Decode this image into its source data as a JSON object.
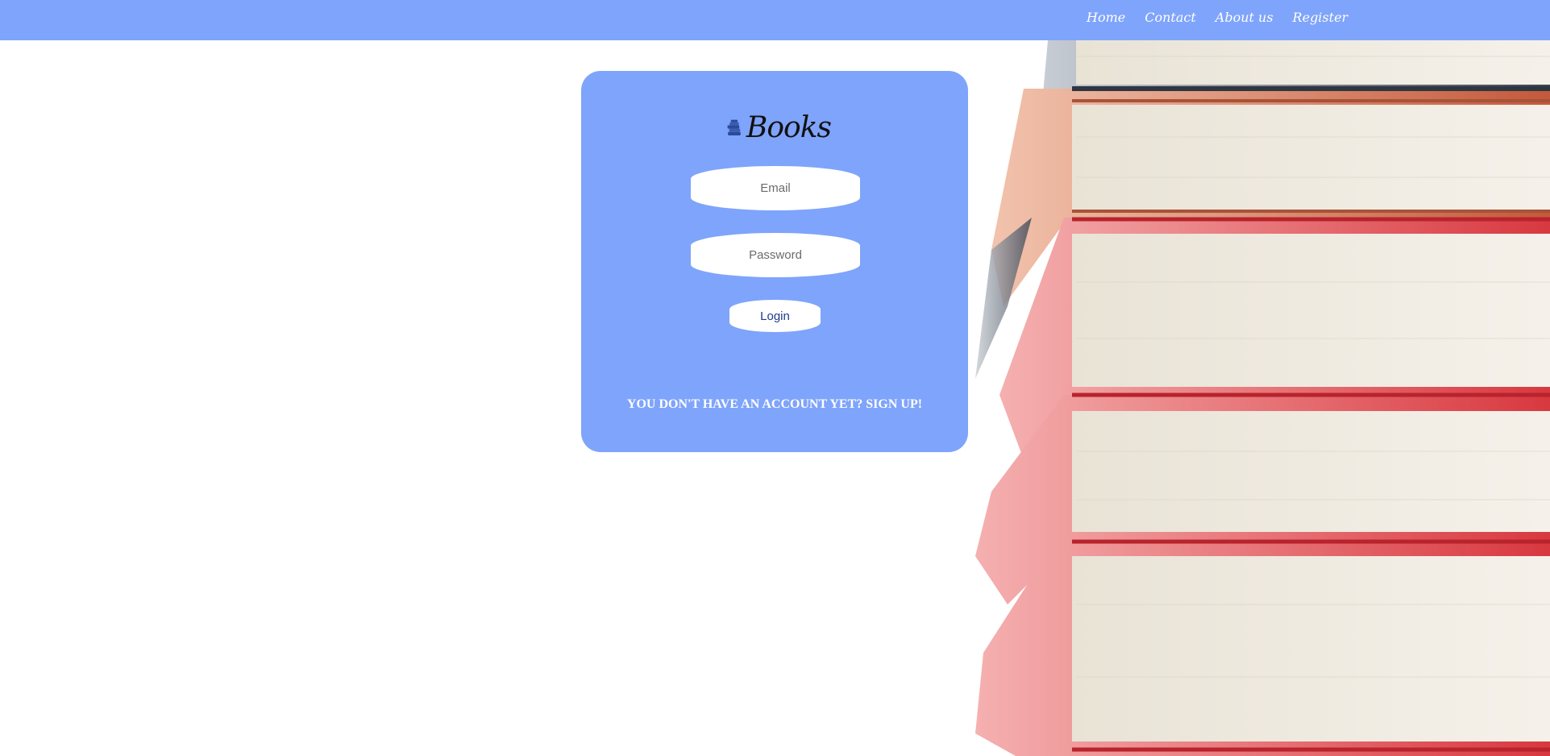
{
  "nav": {
    "links": [
      {
        "label": "Home"
      },
      {
        "label": "Contact"
      },
      {
        "label": "About us"
      },
      {
        "label": "Register"
      }
    ]
  },
  "login": {
    "logo_text": "Books",
    "email_placeholder": "Email",
    "email_value": "",
    "password_placeholder": "Password",
    "password_value": "",
    "login_label": "Login",
    "signup_text": "YOU DON'T HAVE AN ACCOUNT YET? SIGN UP!"
  },
  "colors": {
    "brand_blue": "#7fa4fb",
    "button_text": "#1f3b8e",
    "logo_icon": "#2b4a9a"
  },
  "icons": {
    "logo": "book-stack-icon",
    "hero": "stacked-books-photo"
  }
}
